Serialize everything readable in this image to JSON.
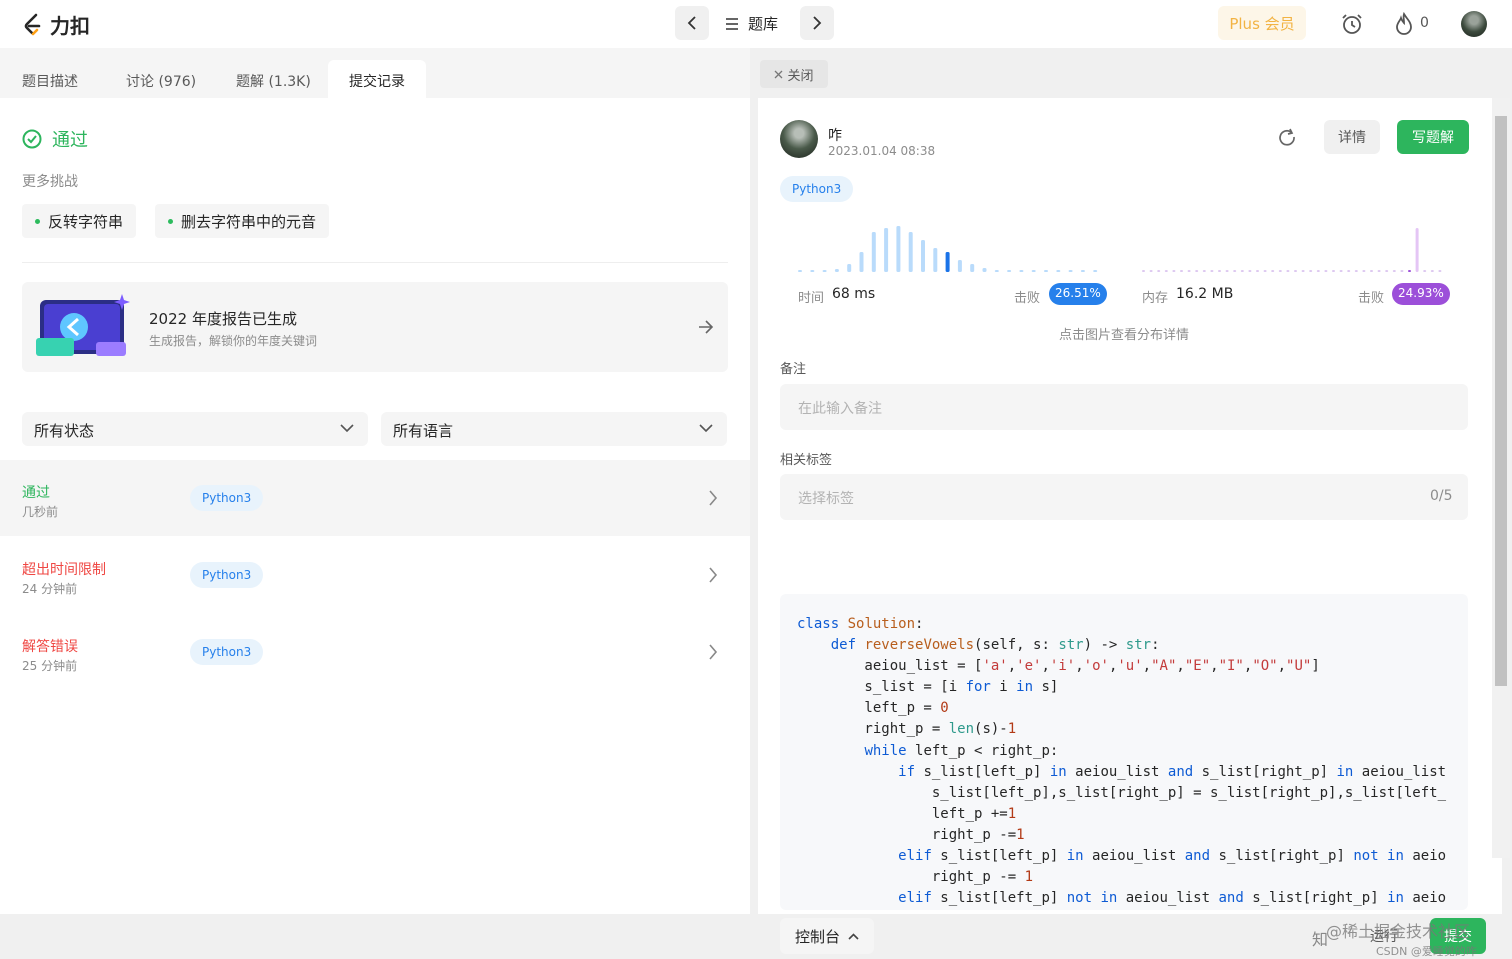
{
  "top": {
    "logo_text": "力扣",
    "tiku_label": "题库",
    "plus_label": "Plus 会员",
    "points": "0"
  },
  "left": {
    "tabs": [
      "题目描述",
      "讨论 (976)",
      "题解 (1.3K)",
      "提交记录"
    ],
    "status_title": "通过",
    "more_label": "更多挑战",
    "challenges": [
      "反转字符串",
      "删去字符串中的元音"
    ],
    "report_title": "2022 年度报告已生成",
    "report_sub": "生成报告，解锁你的年度关键词",
    "filter_status": "所有状态",
    "filter_lang": "所有语言",
    "submissions": [
      {
        "status": "通过",
        "time": "几秒前",
        "lang": "Python3",
        "color": "#2db55d"
      },
      {
        "status": "超出时间限制",
        "time": "24 分钟前",
        "lang": "Python3",
        "color": "#ef4743"
      },
      {
        "status": "解答错误",
        "time": "25 分钟前",
        "lang": "Python3",
        "color": "#ef4743"
      }
    ]
  },
  "right": {
    "close_label": "关闭",
    "user_name": "咋",
    "user_date": "2023.01.04 08:38",
    "detail_label": "详情",
    "write_label": "写题解",
    "lang_badge": "Python3",
    "time_label": "时间",
    "time_value": "68 ms",
    "beat_label": "击败",
    "time_beat": "26.51%",
    "mem_label": "内存",
    "mem_value": "16.2 MB",
    "mem_beat": "24.93%",
    "dist_hint": "点击图片查看分布详情",
    "note_label": "备注",
    "note_placeholder": "在此输入备注",
    "tags_label": "相关标签",
    "tags_placeholder": "选择标签",
    "tags_count": "0/5",
    "console_label": "控制台",
    "run_label": "运行",
    "submit_label": "提交",
    "watermark1": "@稀土掘金技术社区",
    "watermark2": "CSDN @爱睡觉的咋",
    "watermark3": "知"
  },
  "colors": {
    "accent_green": "#2db55d",
    "accent_blue": "#2680eb",
    "accent_purple": "#9c4fd9",
    "error_red": "#ef4743",
    "plus_gold": "#f2b343"
  }
}
